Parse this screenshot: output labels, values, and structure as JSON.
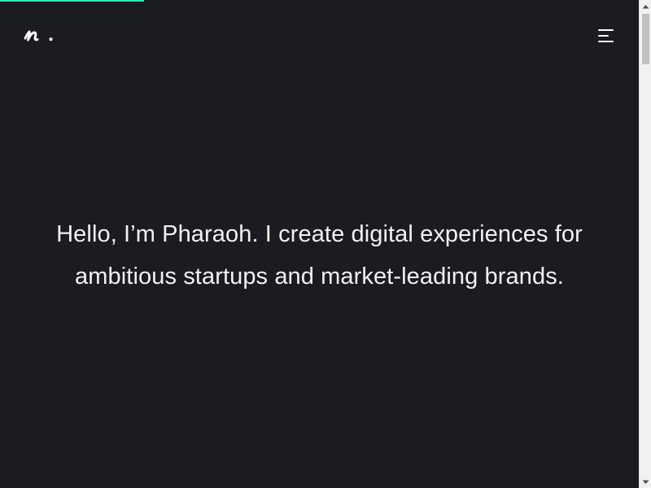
{
  "page": {
    "background_color": "#1b1b22",
    "accent_color": "#2ee6b9"
  },
  "progress": {
    "fraction": 0.225
  },
  "header": {
    "logo_text": "n.",
    "menu_icon": "hamburger-menu-icon"
  },
  "hero": {
    "text": "Hello, I’m Pharaoh. I create digital experiences for ambitious startups and market-leading brands."
  },
  "scrollbar": {
    "up_icon": "scroll-up-arrow-icon",
    "down_icon": "scroll-down-arrow-icon"
  }
}
